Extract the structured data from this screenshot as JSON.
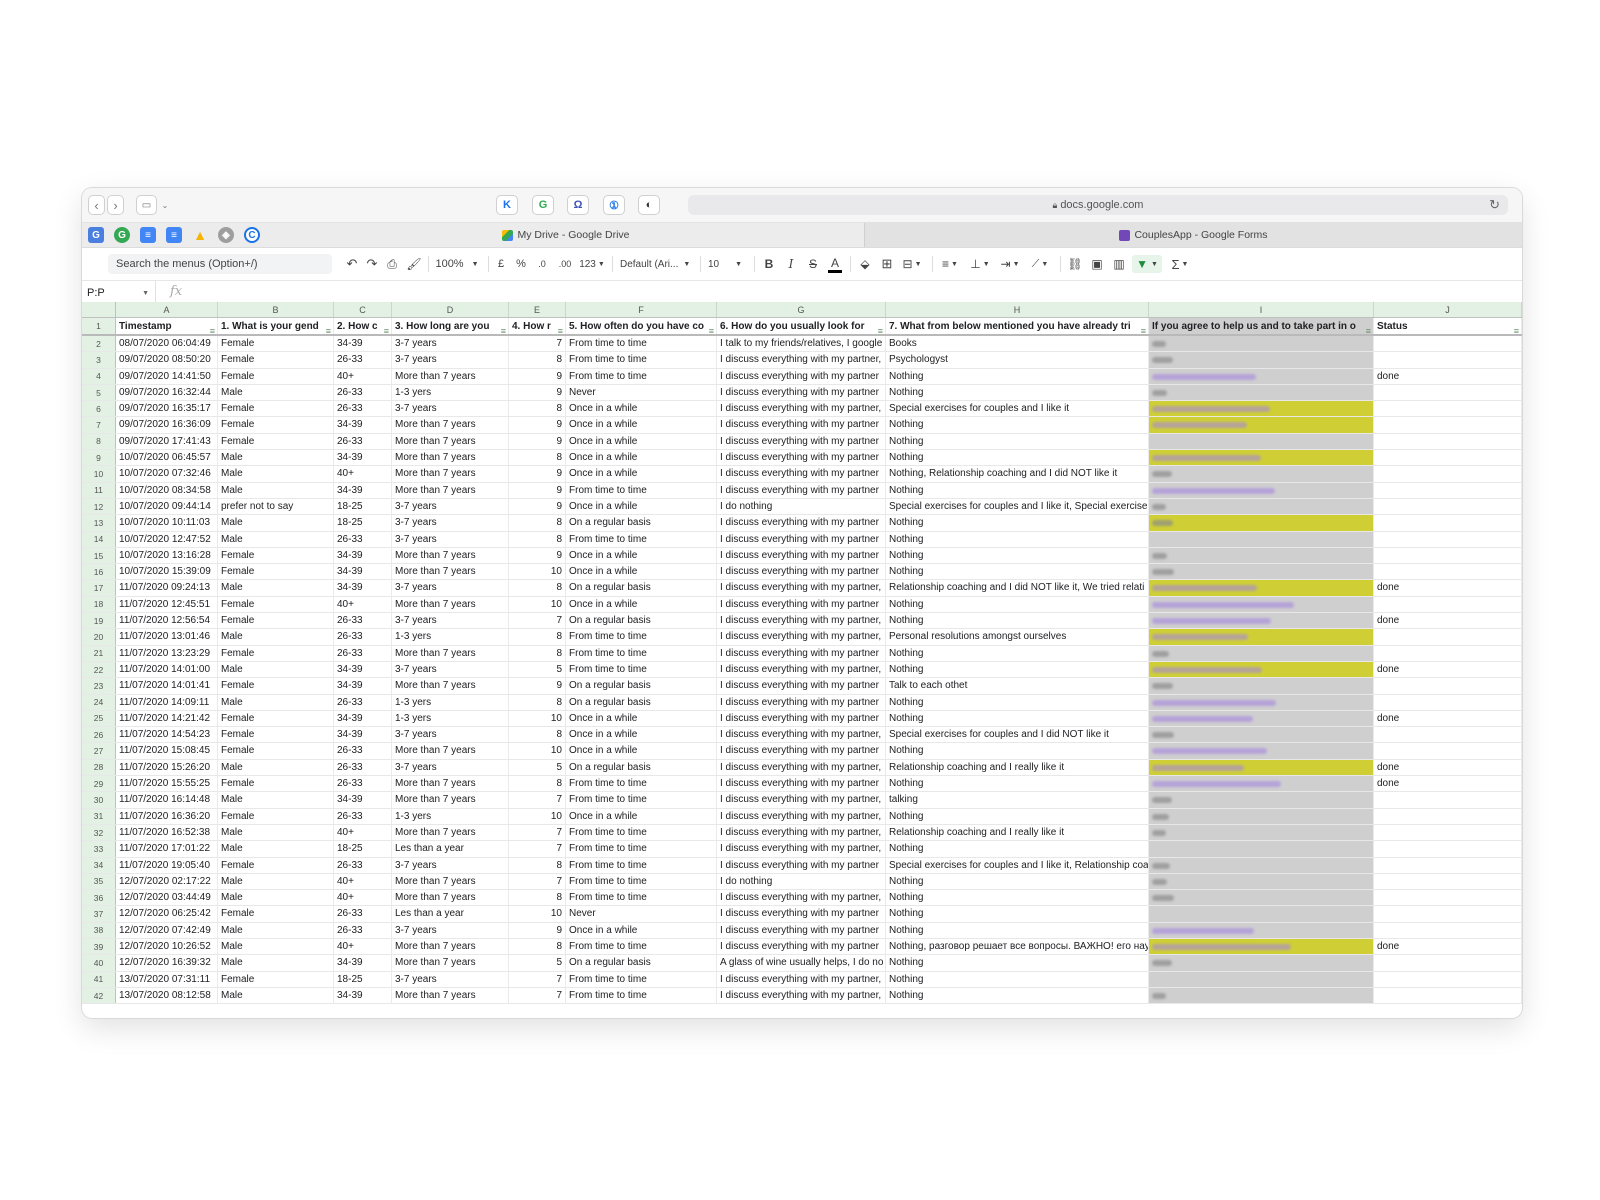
{
  "browser": {
    "url": "docs.google.com",
    "tabs": [
      {
        "label": "My Drive - Google Drive",
        "icon": "google-drive-icon",
        "active": true
      },
      {
        "label": "CouplesApp - Google Forms",
        "icon": "google-forms-icon",
        "active": false
      }
    ]
  },
  "toolbar": {
    "menu_search": "Search the menus (Option+/)",
    "zoom": "100%",
    "currency": "£",
    "percent": "%",
    "dec_decrease": ".0",
    "dec_increase": ".00",
    "format_more": "123",
    "font": "Default (Ari...",
    "font_size": "10",
    "bold": "B",
    "italic": "I",
    "strike": "S",
    "text_color": "A",
    "functions": "Σ"
  },
  "formula_bar": {
    "name_box": "P:P",
    "fx": "fx"
  },
  "sheet": {
    "columns": [
      "A",
      "B",
      "C",
      "D",
      "E",
      "F",
      "G",
      "H",
      "I",
      "J"
    ],
    "headers": [
      "Timestamp",
      "1. What is your gend",
      "2. How c",
      "3. How long are you",
      "4. How r",
      "5. How often do you have co",
      "6. How do you usually look for",
      "7. What from below mentioned you have already tri",
      "If you agree to help us and to take part in o",
      "Status"
    ],
    "rows": [
      [
        "2",
        "08/07/2020 06:04:49",
        "Female",
        "34-39",
        "3-7 years",
        "7",
        "From time to time",
        "I talk to my friends/relatives, I google",
        "Books",
        "g",
        ""
      ],
      [
        "3",
        "09/07/2020 08:50:20",
        "Female",
        "26-33",
        "3-7 years",
        "8",
        "From time to time",
        "I discuss everything with my partner,",
        "Psychologyst",
        "g",
        ""
      ],
      [
        "4",
        "09/07/2020 14:41:50",
        "Female",
        "40+",
        "More than 7 years",
        "9",
        "From time to time",
        "I discuss everything with my partner",
        "Nothing",
        "p",
        "done"
      ],
      [
        "5",
        "09/07/2020 16:32:44",
        "Male",
        "26-33",
        "1-3 yers",
        "9",
        "Never",
        "I discuss everything with my partner",
        "Nothing",
        "g",
        ""
      ],
      [
        "6",
        "09/07/2020 16:35:17",
        "Female",
        "26-33",
        "3-7 years",
        "8",
        "Once in a while",
        "I discuss everything with my partner,",
        "Special exercises for couples and I like it",
        "hp",
        ""
      ],
      [
        "7",
        "09/07/2020 16:36:09",
        "Female",
        "34-39",
        "More than 7 years",
        "9",
        "Once in a while",
        "I discuss everything with my partner",
        "Nothing",
        "hp",
        ""
      ],
      [
        "8",
        "09/07/2020 17:41:43",
        "Female",
        "26-33",
        "More than 7 years",
        "9",
        "Once in a while",
        "I discuss everything with my partner",
        "Nothing",
        "",
        ""
      ],
      [
        "9",
        "10/07/2020 06:45:57",
        "Male",
        "34-39",
        "More than 7 years",
        "8",
        "Once in a while",
        "I discuss everything with my partner",
        "Nothing",
        "hp",
        ""
      ],
      [
        "10",
        "10/07/2020 07:32:46",
        "Male",
        "40+",
        "More than 7 years",
        "9",
        "Once in a while",
        "I discuss everything with my partner",
        "Nothing, Relationship coaching and I did NOT like it",
        "g",
        ""
      ],
      [
        "11",
        "10/07/2020 08:34:58",
        "Male",
        "34-39",
        "More than 7 years",
        "9",
        "From time to time",
        "I discuss everything with my partner",
        "Nothing",
        "p",
        ""
      ],
      [
        "12",
        "10/07/2020 09:44:14",
        "prefer not to say",
        "18-25",
        "3-7 years",
        "9",
        "Once in a while",
        "I do nothing",
        "Special exercises for couples and I like it, Special exercise",
        "g",
        ""
      ],
      [
        "13",
        "10/07/2020 10:11:03",
        "Male",
        "18-25",
        "3-7 years",
        "8",
        "On a regular basis",
        "I discuss everything with my partner",
        "Nothing",
        "hg",
        ""
      ],
      [
        "14",
        "10/07/2020 12:47:52",
        "Male",
        "26-33",
        "3-7 years",
        "8",
        "From time to time",
        "I discuss everything with my partner",
        "Nothing",
        "",
        ""
      ],
      [
        "15",
        "10/07/2020 13:16:28",
        "Female",
        "34-39",
        "More than 7 years",
        "9",
        "Once in a while",
        "I discuss everything with my partner",
        "Nothing",
        "g",
        ""
      ],
      [
        "16",
        "10/07/2020 15:39:09",
        "Female",
        "34-39",
        "More than 7 years",
        "10",
        "Once in a while",
        "I discuss everything with my partner",
        "Nothing",
        "g",
        ""
      ],
      [
        "17",
        "11/07/2020 09:24:13",
        "Male",
        "34-39",
        "3-7 years",
        "8",
        "On a regular basis",
        "I discuss everything with my partner,",
        "Relationship coaching and I did NOT like it, We tried relati",
        "hp",
        "done"
      ],
      [
        "18",
        "11/07/2020 12:45:51",
        "Female",
        "40+",
        "More than 7 years",
        "10",
        "Once in a while",
        "I discuss everything with my partner",
        "Nothing",
        "p",
        ""
      ],
      [
        "19",
        "11/07/2020 12:56:54",
        "Female",
        "26-33",
        "3-7 years",
        "7",
        "On a regular basis",
        "I discuss everything with my partner,",
        "Nothing",
        "p",
        "done"
      ],
      [
        "20",
        "11/07/2020 13:01:46",
        "Male",
        "26-33",
        "1-3 yers",
        "8",
        "From time to time",
        "I discuss everything with my partner,",
        "Personal resolutions amongst ourselves",
        "hp",
        ""
      ],
      [
        "21",
        "11/07/2020 13:23:29",
        "Female",
        "26-33",
        "More than 7 years",
        "8",
        "From time to time",
        "I discuss everything with my partner",
        "Nothing",
        "g",
        ""
      ],
      [
        "22",
        "11/07/2020 14:01:00",
        "Male",
        "34-39",
        "3-7 years",
        "5",
        "From time to time",
        "I discuss everything with my partner,",
        "Nothing",
        "hp",
        "done"
      ],
      [
        "23",
        "11/07/2020 14:01:41",
        "Female",
        "34-39",
        "More than 7 years",
        "9",
        "On a regular basis",
        "I discuss everything with my partner",
        "Talk to each othet",
        "g",
        ""
      ],
      [
        "24",
        "11/07/2020 14:09:11",
        "Male",
        "26-33",
        "1-3 yers",
        "8",
        "On a regular basis",
        "I discuss everything with my partner",
        "Nothing",
        "p",
        ""
      ],
      [
        "25",
        "11/07/2020 14:21:42",
        "Female",
        "34-39",
        "1-3 yers",
        "10",
        "Once in a while",
        "I discuss everything with my partner",
        "Nothing",
        "p",
        "done"
      ],
      [
        "26",
        "11/07/2020 14:54:23",
        "Female",
        "34-39",
        "3-7 years",
        "8",
        "Once in a while",
        "I discuss everything with my partner,",
        "Special exercises for couples and I did NOT like it",
        "g",
        ""
      ],
      [
        "27",
        "11/07/2020 15:08:45",
        "Female",
        "26-33",
        "More than 7 years",
        "10",
        "Once in a while",
        "I discuss everything with my partner",
        "Nothing",
        "p",
        ""
      ],
      [
        "28",
        "11/07/2020 15:26:20",
        "Male",
        "26-33",
        "3-7 years",
        "5",
        "On a regular basis",
        "I discuss everything with my partner,",
        "Relationship coaching and I really like it",
        "hp",
        "done"
      ],
      [
        "29",
        "11/07/2020 15:55:25",
        "Female",
        "26-33",
        "More than 7 years",
        "8",
        "From time to time",
        "I discuss everything with my partner",
        "Nothing",
        "p",
        "done"
      ],
      [
        "30",
        "11/07/2020 16:14:48",
        "Male",
        "34-39",
        "More than 7 years",
        "7",
        "From time to time",
        "I discuss everything with my partner,",
        "talking",
        "g",
        ""
      ],
      [
        "31",
        "11/07/2020 16:36:20",
        "Female",
        "26-33",
        "1-3 yers",
        "10",
        "Once in a while",
        "I discuss everything with my partner,",
        "Nothing",
        "g",
        ""
      ],
      [
        "32",
        "11/07/2020 16:52:38",
        "Male",
        "40+",
        "More than 7 years",
        "7",
        "From time to time",
        "I discuss everything with my partner,",
        "Relationship coaching and I really like it",
        "g",
        ""
      ],
      [
        "33",
        "11/07/2020 17:01:22",
        "Male",
        "18-25",
        "Les than a year",
        "7",
        "From time to time",
        "I discuss everything with my partner,",
        "Nothing",
        "",
        ""
      ],
      [
        "34",
        "11/07/2020 19:05:40",
        "Female",
        "26-33",
        "3-7 years",
        "8",
        "From time to time",
        "I discuss everything with my partner",
        "Special exercises for couples and I like it, Relationship coa",
        "g",
        ""
      ],
      [
        "35",
        "12/07/2020 02:17:22",
        "Male",
        "40+",
        "More than 7 years",
        "7",
        "From time to time",
        "I do nothing",
        "Nothing",
        "g",
        ""
      ],
      [
        "36",
        "12/07/2020 03:44:49",
        "Male",
        "40+",
        "More than 7 years",
        "8",
        "From time to time",
        "I discuss everything with my partner,",
        "Nothing",
        "g",
        ""
      ],
      [
        "37",
        "12/07/2020 06:25:42",
        "Female",
        "26-33",
        "Les than a year",
        "10",
        "Never",
        "I discuss everything with my partner",
        "Nothing",
        "",
        ""
      ],
      [
        "38",
        "12/07/2020 07:42:49",
        "Male",
        "26-33",
        "3-7 years",
        "9",
        "Once in a while",
        "I discuss everything with my partner",
        "Nothing",
        "p",
        ""
      ],
      [
        "39",
        "12/07/2020 10:26:52",
        "Male",
        "40+",
        "More than 7 years",
        "8",
        "From time to time",
        "I discuss everything with my partner",
        "Nothing, разговор решает все вопросы. ВАЖНО! его нау",
        "hp",
        "done"
      ],
      [
        "40",
        "12/07/2020 16:39:32",
        "Male",
        "34-39",
        "More than 7 years",
        "5",
        "On a regular basis",
        "A glass of wine usually helps, I do no",
        "Nothing",
        "g",
        ""
      ],
      [
        "41",
        "13/07/2020 07:31:11",
        "Female",
        "18-25",
        "3-7 years",
        "7",
        "From time to time",
        "I discuss everything with my partner,",
        "Nothing",
        "",
        ""
      ],
      [
        "42",
        "13/07/2020 08:12:58",
        "Male",
        "34-39",
        "More than 7 years",
        "7",
        "From time to time",
        "I discuss everything with my partner,",
        "Nothing",
        "g",
        ""
      ]
    ]
  },
  "colors": {
    "header_green": "#e3f0e4",
    "highlight_yellow": "#cfcf35",
    "column_i_gray": "#cfcfcf",
    "filter_green": "#1e8e3e"
  }
}
